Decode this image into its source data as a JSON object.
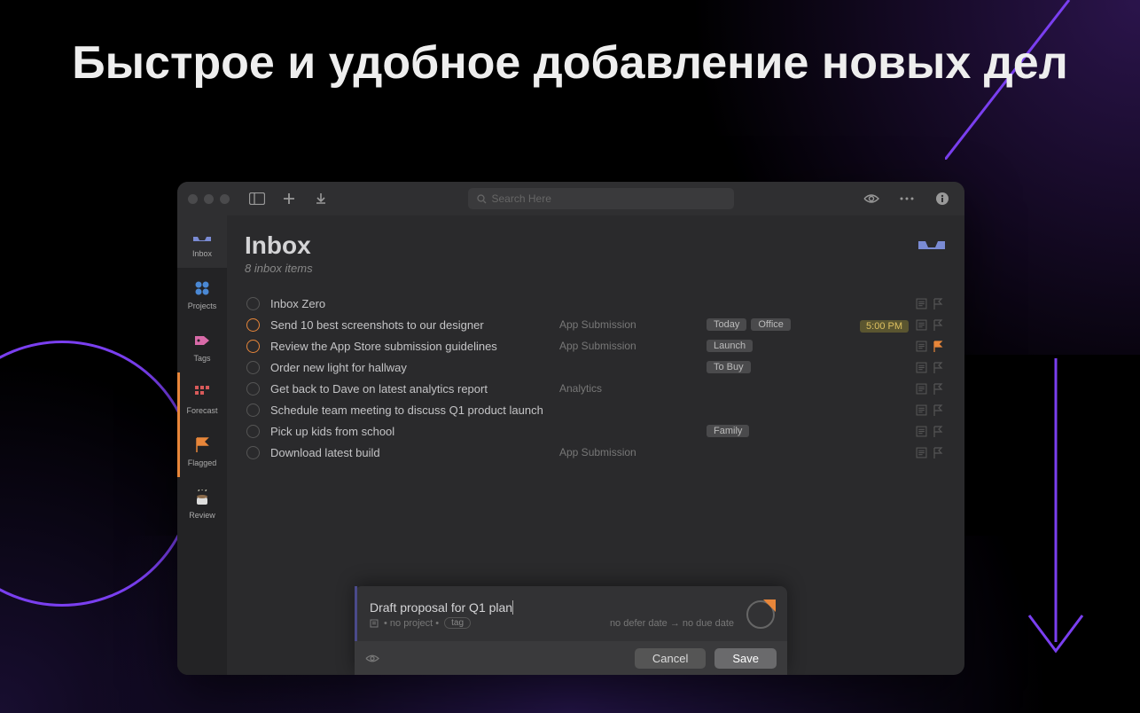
{
  "headline": "Быстрое и удобное добавление новых дел",
  "search": {
    "placeholder": "Search Here"
  },
  "sidebar": {
    "items": [
      {
        "label": "Inbox"
      },
      {
        "label": "Projects"
      },
      {
        "label": "Tags"
      },
      {
        "label": "Forecast"
      },
      {
        "label": "Flagged"
      },
      {
        "label": "Review"
      }
    ]
  },
  "inbox": {
    "title": "Inbox",
    "subtitle": "8 inbox items"
  },
  "tasks": [
    {
      "title": "Inbox Zero",
      "project": "",
      "tags": [],
      "time": "",
      "flagged": false
    },
    {
      "title": "Send 10 best screenshots to our designer",
      "project": "App Submission",
      "tags": [
        "Today",
        "Office"
      ],
      "time": "5:00 PM",
      "flagged": false,
      "orange": true
    },
    {
      "title": "Review the App Store submission guidelines",
      "project": "App Submission",
      "tags": [
        "Launch"
      ],
      "time": "",
      "flagged": true,
      "orange": true
    },
    {
      "title": "Order new light for hallway",
      "project": "",
      "tags": [
        "To Buy"
      ],
      "time": "",
      "flagged": false
    },
    {
      "title": "Get back to Dave on latest analytics report",
      "project": "Analytics",
      "tags": [],
      "time": "",
      "flagged": false
    },
    {
      "title": "Schedule team meeting to discuss Q1 product launch",
      "project": "",
      "tags": [],
      "time": "",
      "flagged": false
    },
    {
      "title": "Pick up kids from school",
      "project": "",
      "tags": [
        "Family"
      ],
      "time": "",
      "flagged": false
    },
    {
      "title": "Download latest build",
      "project": "App Submission",
      "tags": [],
      "time": "",
      "flagged": false
    }
  ],
  "quick_entry": {
    "title": "Draft proposal for Q1 plan",
    "no_project": "• no project •",
    "tag_chip": "tag",
    "dates": "no defer date → no due date",
    "cancel": "Cancel",
    "save": "Save"
  }
}
